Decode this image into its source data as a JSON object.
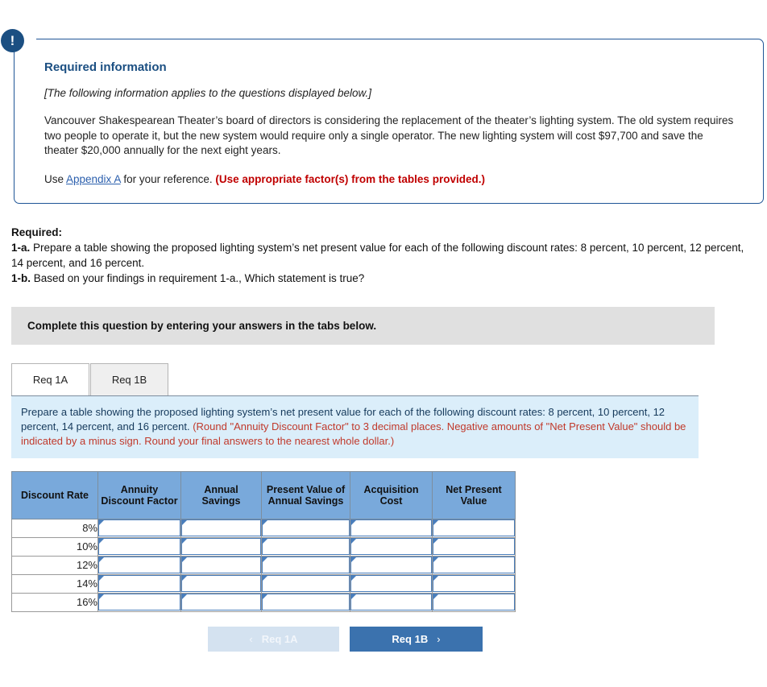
{
  "callout": {
    "icon": "exclamation-icon",
    "title": "Required information",
    "italic_note": "[The following information applies to the questions displayed below.]",
    "body": "Vancouver Shakespearean Theater’s board of directors is considering the replacement of the theater’s lighting system. The old system requires two people to operate it, but the new system would require only a single operator. The new lighting system will cost $97,700 and save the theater $20,000 annually for the next eight years.",
    "use_prefix": "Use ",
    "link_label": "Appendix A",
    "use_suffix": " for your reference. ",
    "use_bold_red": "(Use appropriate factor(s) from the tables provided.)"
  },
  "required": {
    "heading": "Required:",
    "item_a_label": "1-a.",
    "item_a_text": " Prepare a table showing the proposed lighting system’s net present value for each of the following discount rates: 8 percent, 10 percent, 12 percent, 14 percent, and 16 percent.",
    "item_b_label": "1-b.",
    "item_b_text": " Based on your findings in requirement 1-a., Which statement is true?"
  },
  "instruction_bar": {
    "text": "Complete this question by entering your answers in the tabs below."
  },
  "tabs": [
    {
      "label": "Req 1A",
      "active": true
    },
    {
      "label": "Req 1B",
      "active": false
    }
  ],
  "blue_panel": {
    "main_text": "Prepare a table showing the proposed lighting system’s net present value for each of the following discount rates: 8 percent, 10 percent, 12 percent, 14 percent, and 16 percent. ",
    "red_text": "(Round \"Annuity Discount Factor\" to 3 decimal places. Negative amounts of \"Net Present Value\" should be indicated by a minus sign. Round your final answers to the nearest whole dollar.)"
  },
  "table": {
    "headers": [
      "Discount Rate",
      "Annuity Discount Factor",
      "Annual Savings",
      "Present Value of Annual Savings",
      "Acquisition Cost",
      "Net Present Value"
    ],
    "rows": [
      {
        "rate": "8%",
        "annuity_discount_factor": "",
        "annual_savings": "",
        "pv_annual_savings": "",
        "acquisition_cost": "",
        "net_present_value": ""
      },
      {
        "rate": "10%",
        "annuity_discount_factor": "",
        "annual_savings": "",
        "pv_annual_savings": "",
        "acquisition_cost": "",
        "net_present_value": ""
      },
      {
        "rate": "12%",
        "annuity_discount_factor": "",
        "annual_savings": "",
        "pv_annual_savings": "",
        "acquisition_cost": "",
        "net_present_value": ""
      },
      {
        "rate": "14%",
        "annuity_discount_factor": "",
        "annual_savings": "",
        "pv_annual_savings": "",
        "acquisition_cost": "",
        "net_present_value": ""
      },
      {
        "rate": "16%",
        "annuity_discount_factor": "",
        "annual_savings": "",
        "pv_annual_savings": "",
        "acquisition_cost": "",
        "net_present_value": ""
      }
    ]
  },
  "nav": {
    "prev_label": "Req 1A",
    "prev_chevron": "‹",
    "next_label": "Req 1B",
    "next_chevron": "›"
  },
  "colors": {
    "accent_blue": "#1b4f82",
    "link_blue": "#2b5fad",
    "red": "#c00000",
    "panel_blue_bg": "#dbeefa",
    "table_header_blue": "#79a9db",
    "gray_bar": "#e0e0e0",
    "btn_next_blue": "#3b72ae",
    "btn_prev_blue": "#d4e2f0"
  }
}
